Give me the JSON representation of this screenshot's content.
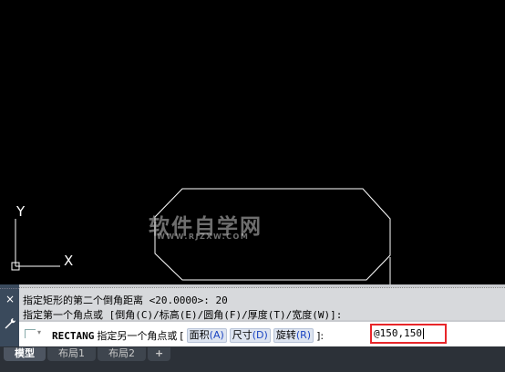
{
  "drawing": {
    "watermark_main": "软件自学网",
    "watermark_sub": "WWW.RJZXW.COM",
    "ucs_y_label": "Y",
    "ucs_x_label": "X"
  },
  "command_history": [
    "指定矩形的第二个倒角距离 <20.0000>: 20",
    "指定第一个角点或 [倒角(C)/标高(E)/圆角(F)/厚度(T)/宽度(W)]:"
  ],
  "command_line": {
    "command_name": "RECTANG",
    "prompt": "指定另一个角点或",
    "open_bracket": "[",
    "options": [
      {
        "label": "面积",
        "key": "(A)"
      },
      {
        "label": "尺寸",
        "key": "(D)"
      },
      {
        "label": "旋转",
        "key": "(R)"
      }
    ],
    "close_bracket": "]:",
    "input_value": "@150,150"
  },
  "side_buttons": {
    "close": "×"
  },
  "tabs": [
    {
      "label": "模型",
      "active": true
    },
    {
      "label": "布局1",
      "active": false
    },
    {
      "label": "布局2",
      "active": false
    },
    {
      "label": "+",
      "active": false
    }
  ],
  "colors": {
    "canvas_bg": "#000000",
    "geometry_stroke": "#ffffff",
    "highlight_box": "#e8262a",
    "option_key": "#1a44c2"
  }
}
